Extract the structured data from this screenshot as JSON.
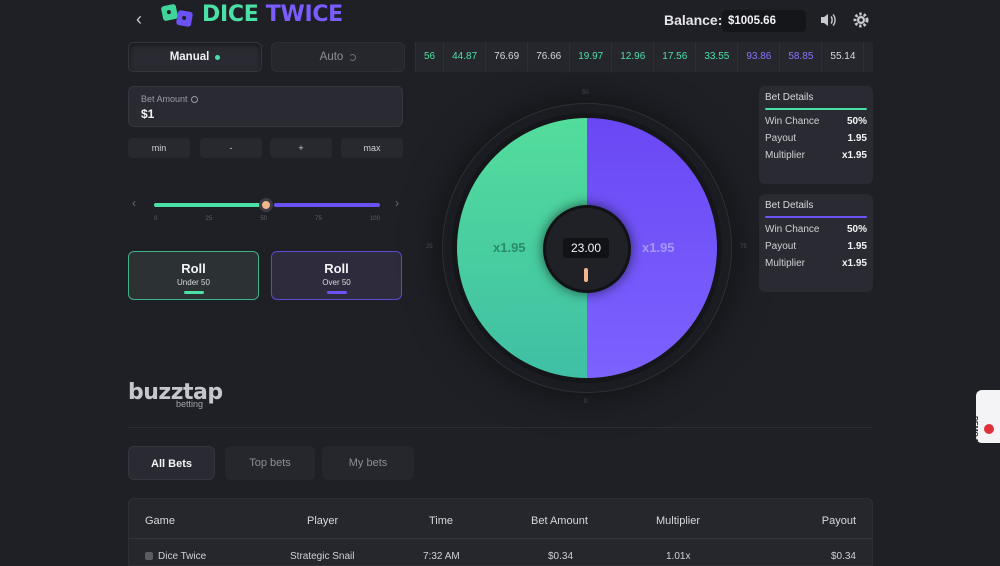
{
  "header": {
    "back_icon": "chevron-left-icon",
    "logo_part1": "DICE",
    "logo_part2": "TWICE",
    "balance_label": "Balance:",
    "balance_value": "$1005.66",
    "sound_icon": "speaker-icon",
    "settings_icon": "gear-icon"
  },
  "modes": {
    "manual": "Manual",
    "auto": "Auto"
  },
  "history": [
    {
      "v": "56",
      "c": "green"
    },
    {
      "v": "44.87",
      "c": "green"
    },
    {
      "v": "76.69",
      "c": "white"
    },
    {
      "v": "76.66",
      "c": "white"
    },
    {
      "v": "19.97",
      "c": "green"
    },
    {
      "v": "12.96",
      "c": "green"
    },
    {
      "v": "17.56",
      "c": "green"
    },
    {
      "v": "33.55",
      "c": "green"
    },
    {
      "v": "93.86",
      "c": "purple"
    },
    {
      "v": "58.85",
      "c": "purple"
    },
    {
      "v": "55.14",
      "c": "white"
    },
    {
      "v": "23.00",
      "c": "green"
    }
  ],
  "bet": {
    "label": "Bet Amount",
    "value": "$1",
    "chips": [
      "min",
      "-",
      "+",
      "max"
    ]
  },
  "slider": {
    "value_percent": 50,
    "ticks": [
      "0",
      "25",
      "50",
      "75",
      "100"
    ]
  },
  "roll_under": {
    "title": "Roll",
    "sub": "Under 50"
  },
  "roll_over": {
    "title": "Roll",
    "sub": "Over 50"
  },
  "wheel": {
    "left_multiplier": "x1.95",
    "right_multiplier": "x1.95",
    "result": "23.00",
    "tick_top": "50",
    "tick_bottom": "0",
    "tick_left": "25",
    "tick_right": "75"
  },
  "details_under": {
    "head": "Bet Details",
    "rows": [
      {
        "k": "Win Chance",
        "v": "50%"
      },
      {
        "k": "Payout",
        "v": "1.95"
      },
      {
        "k": "Multiplier",
        "v": "x1.95"
      }
    ]
  },
  "details_over": {
    "head": "Bet Details",
    "rows": [
      {
        "k": "Win Chance",
        "v": "50%"
      },
      {
        "k": "Payout",
        "v": "1.95"
      },
      {
        "k": "Multiplier",
        "v": "x1.95"
      }
    ]
  },
  "brand": {
    "name": "buzztap",
    "sub": "betting"
  },
  "tabs": {
    "all": "All Bets",
    "top": "Top bets",
    "my": "My bets"
  },
  "table": {
    "headers": [
      "Game",
      "Player",
      "Time",
      "Bet Amount",
      "Multiplier",
      "Payout"
    ],
    "rows": [
      [
        "Dice Twice",
        "Strategic Snail",
        "7:32 AM",
        "$0.34",
        "1.01x",
        "$0.34"
      ]
    ]
  },
  "demo_badge": "DEMO MODE",
  "colors": {
    "green": "#4be0a5",
    "purple": "#6b52f5",
    "bg": "#1f2026"
  }
}
